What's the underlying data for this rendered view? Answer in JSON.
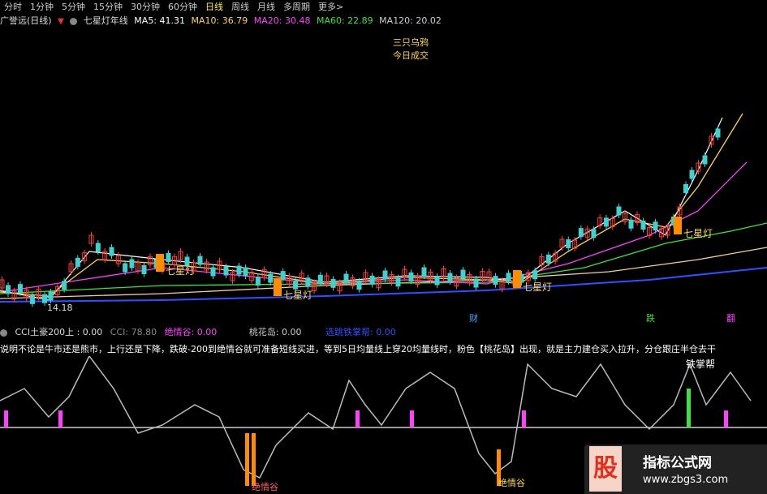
{
  "toolbar": {
    "items": [
      "分时",
      "1分钟",
      "5分钟",
      "15分钟",
      "30分钟",
      "60分钟",
      "日线",
      "周线",
      "月线",
      "多周期",
      "更多>"
    ],
    "active": "日线"
  },
  "info": {
    "stock": "广誉远(日线)",
    "indicator_name": "七星灯年线",
    "ma5": "MA5: 41.31",
    "ma10": "MA10: 36.79",
    "ma20": "MA20: 30.48",
    "ma60": "MA60: 22.89",
    "ma120": "MA120: 20.02",
    "corner_line1": "三只乌鸦",
    "corner_line2": "今日成交"
  },
  "chart": {
    "low_label": "14.18",
    "signal_label": "七星灯",
    "annotation_1": "七星灯",
    "annotation_2": "七星灯",
    "annotation_3": "七星灯",
    "annotation_4": "七星灯",
    "bottom_tag_1": "财",
    "bottom_tag_2": "跌",
    "bottom_tag_3": "翻"
  },
  "sub": {
    "cci_label": "CCI土豪200上 : 0.00",
    "cci_value": "CCI: 78.80",
    "jqg": "绝情谷: 0.00",
    "thd": "桃花岛: 0.00",
    "xzt": "选跳铁掌帮: 0.00",
    "desc": "说明不论是牛市还是熊市，上行还是下降，跌破-200到绝情谷就可准备短线买进，等到5日均量线上穿20均量线时，粉色【桃花岛】出现，就是主力建仓买入拉升，分仓跟庄半仓去干",
    "tzb": "铁掌帮",
    "jqg_mark_1": "绝情谷",
    "jqg_mark_2": "绝情谷"
  },
  "watermark": {
    "logo": "股",
    "title": "指标公式网",
    "url": "www.zbgs3.com"
  },
  "colors": {
    "ma5": "#ffffff",
    "ma10": "#ffd84d",
    "ma20": "#ff40ff",
    "ma60": "#40e040",
    "ma120": "#3050ff",
    "up": "#ff3b3b",
    "down": "#3fd0d0",
    "ma_long": "#f0d0a0"
  }
}
